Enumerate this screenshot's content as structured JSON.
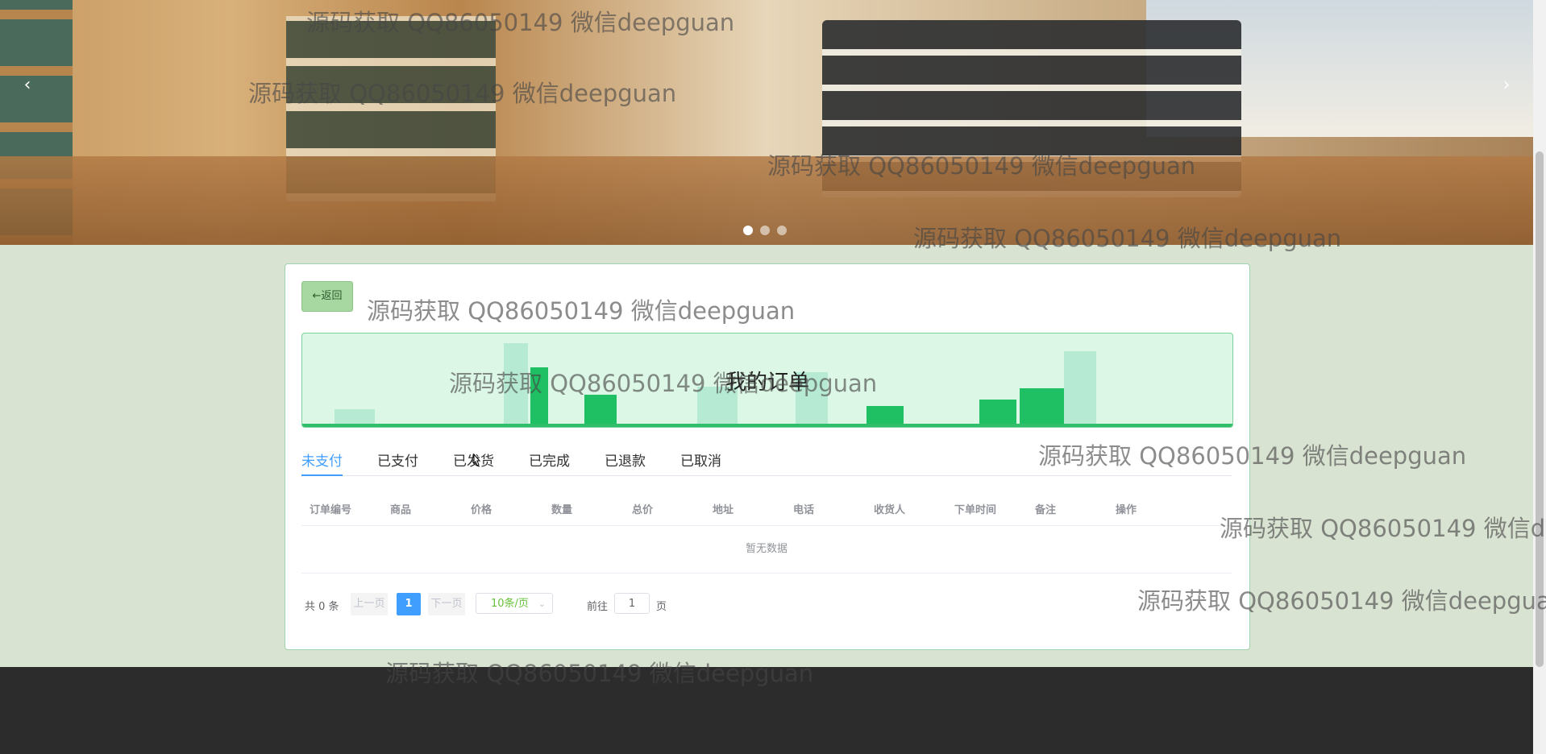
{
  "carousel": {
    "prev_icon": "chevron-left-icon",
    "next_icon": "chevron-right-icon",
    "prev_glyph": "‹",
    "next_glyph": "›",
    "slide_count": 3,
    "active_slide": 1
  },
  "card": {
    "back_label": "←返回",
    "title": "我的订单"
  },
  "tabs": [
    {
      "label": "未支付",
      "active": true
    },
    {
      "label": "已支付",
      "active": false
    },
    {
      "label": "已发货",
      "active": false
    },
    {
      "label": "已完成",
      "active": false
    },
    {
      "label": "已退款",
      "active": false
    },
    {
      "label": "已取消",
      "active": false
    }
  ],
  "table": {
    "columns": [
      "订单编号",
      "商品",
      "价格",
      "数量",
      "总价",
      "地址",
      "电话",
      "收货人",
      "下单时间",
      "备注",
      "操作"
    ],
    "empty_text": "暂无数据"
  },
  "pagination": {
    "total": "共 0 条",
    "prev": "上一页",
    "current_page": "1",
    "next": "下一页",
    "page_size": "10条/页",
    "goto_label": "前往",
    "goto_value": "1",
    "goto_suffix": "页"
  },
  "watermark_text": "源码获取 QQ86050149 微信deepguan",
  "colors": {
    "accent": "#409eff",
    "back_button": "#a8d8a2",
    "title_banner": "#dcf7e5",
    "footer": "#2c2c2c"
  }
}
